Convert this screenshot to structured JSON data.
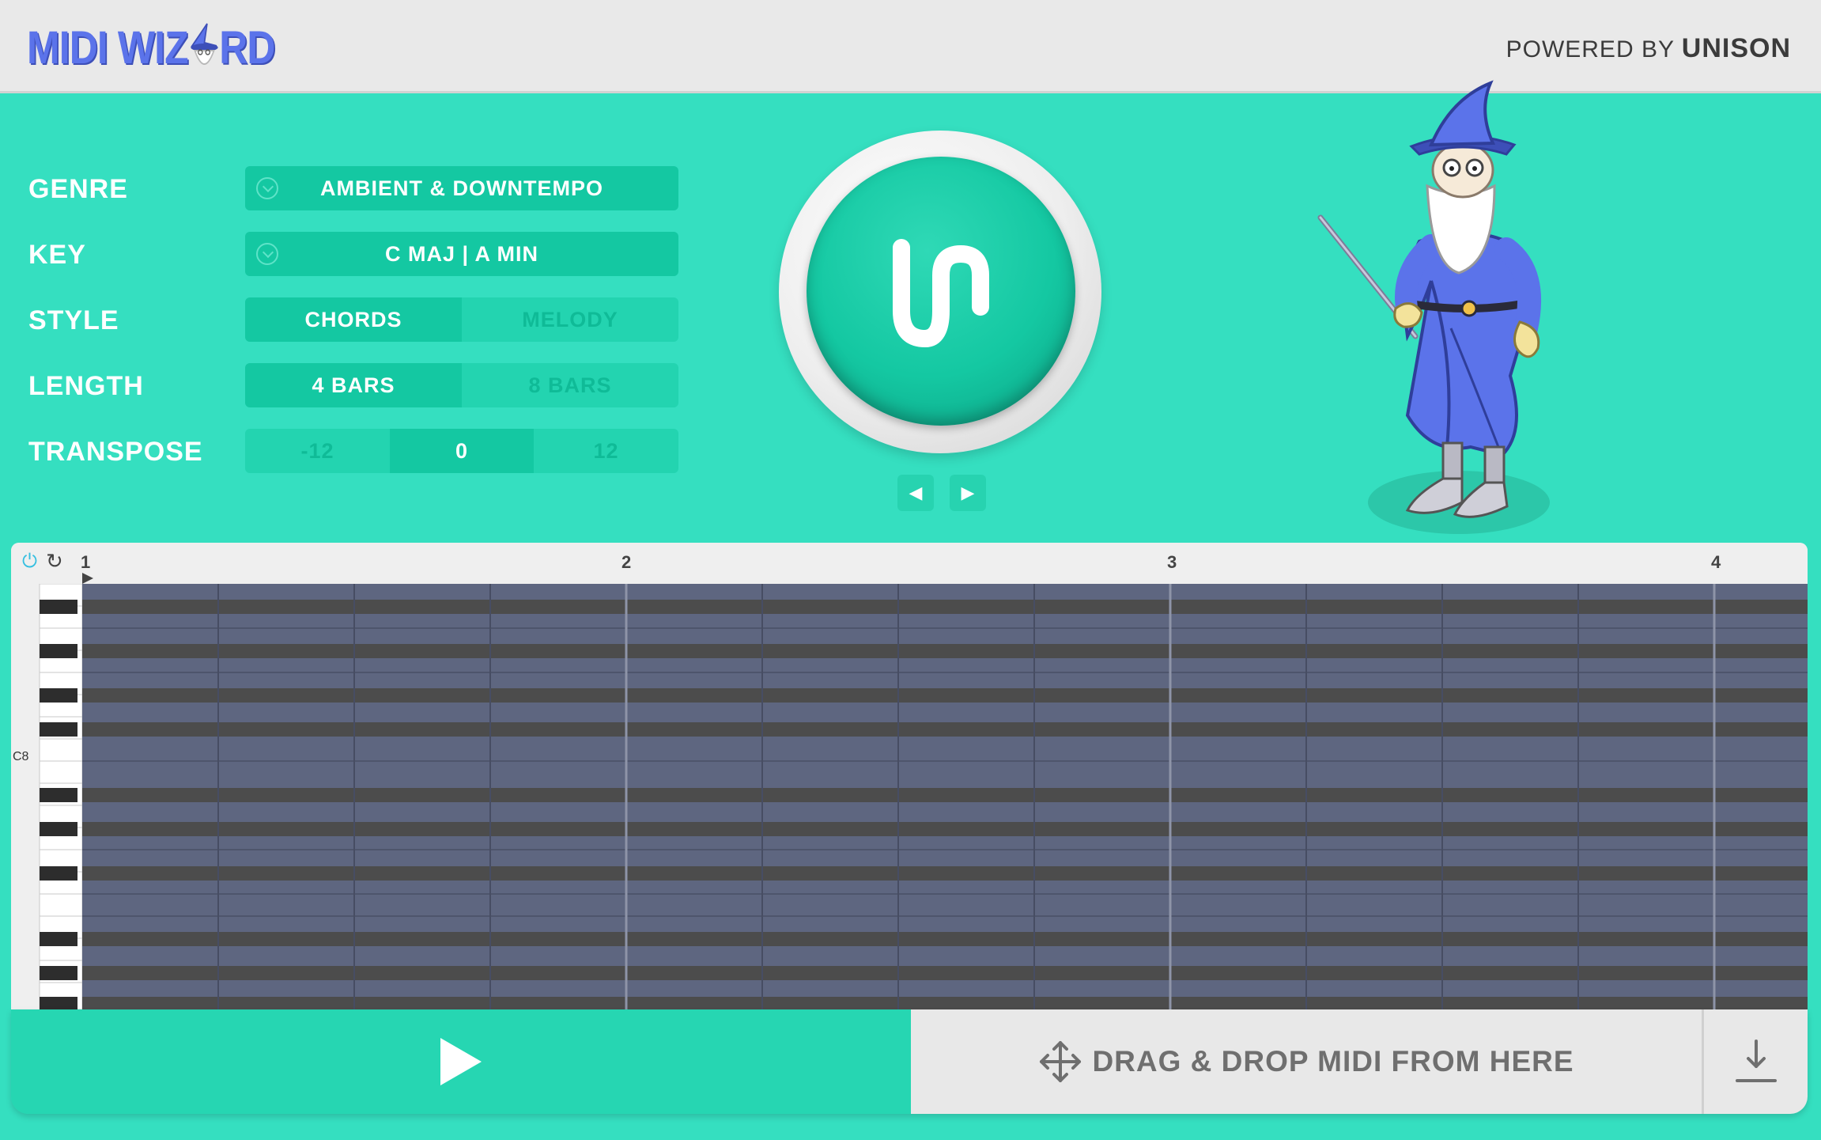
{
  "header": {
    "logo_text_left": "MIDI WIZ",
    "logo_text_right": "RD",
    "powered_by": "POWERED BY",
    "brand": "UNISON"
  },
  "params": {
    "genre": {
      "label": "GENRE",
      "value": "AMBIENT & DOWNTEMPO"
    },
    "key": {
      "label": "KEY",
      "value": "C MAJ | A MIN"
    },
    "style": {
      "label": "STYLE",
      "options": [
        "CHORDS",
        "MELODY"
      ],
      "selected": "CHORDS"
    },
    "length": {
      "label": "LENGTH",
      "options": [
        "4 BARS",
        "8 BARS"
      ],
      "selected": "4 BARS"
    },
    "transpose": {
      "label": "TRANSPOSE",
      "options": [
        "-12",
        "0",
        "12"
      ],
      "selected": "0"
    }
  },
  "generator": {
    "button_icon": "unison-logo-icon",
    "prev_icon": "triangle-left-icon",
    "next_icon": "triangle-right-icon"
  },
  "piano_roll": {
    "bar_numbers": [
      "1",
      "2",
      "3",
      "4"
    ],
    "key_label": "C8",
    "loop_icons": [
      "power-icon",
      "loop-icon"
    ]
  },
  "bottom": {
    "play_icon": "play-icon",
    "drag_label": "DRAG & DROP MIDI FROM HERE",
    "drag_icon": "move-arrows-icon",
    "download_icon": "download-icon"
  },
  "colors": {
    "background": "#35dfc0",
    "accent": "#14c8a2",
    "logo": "#5b73ea",
    "grid_light": "#5e6680",
    "grid_dark": "#4c4c4c"
  }
}
